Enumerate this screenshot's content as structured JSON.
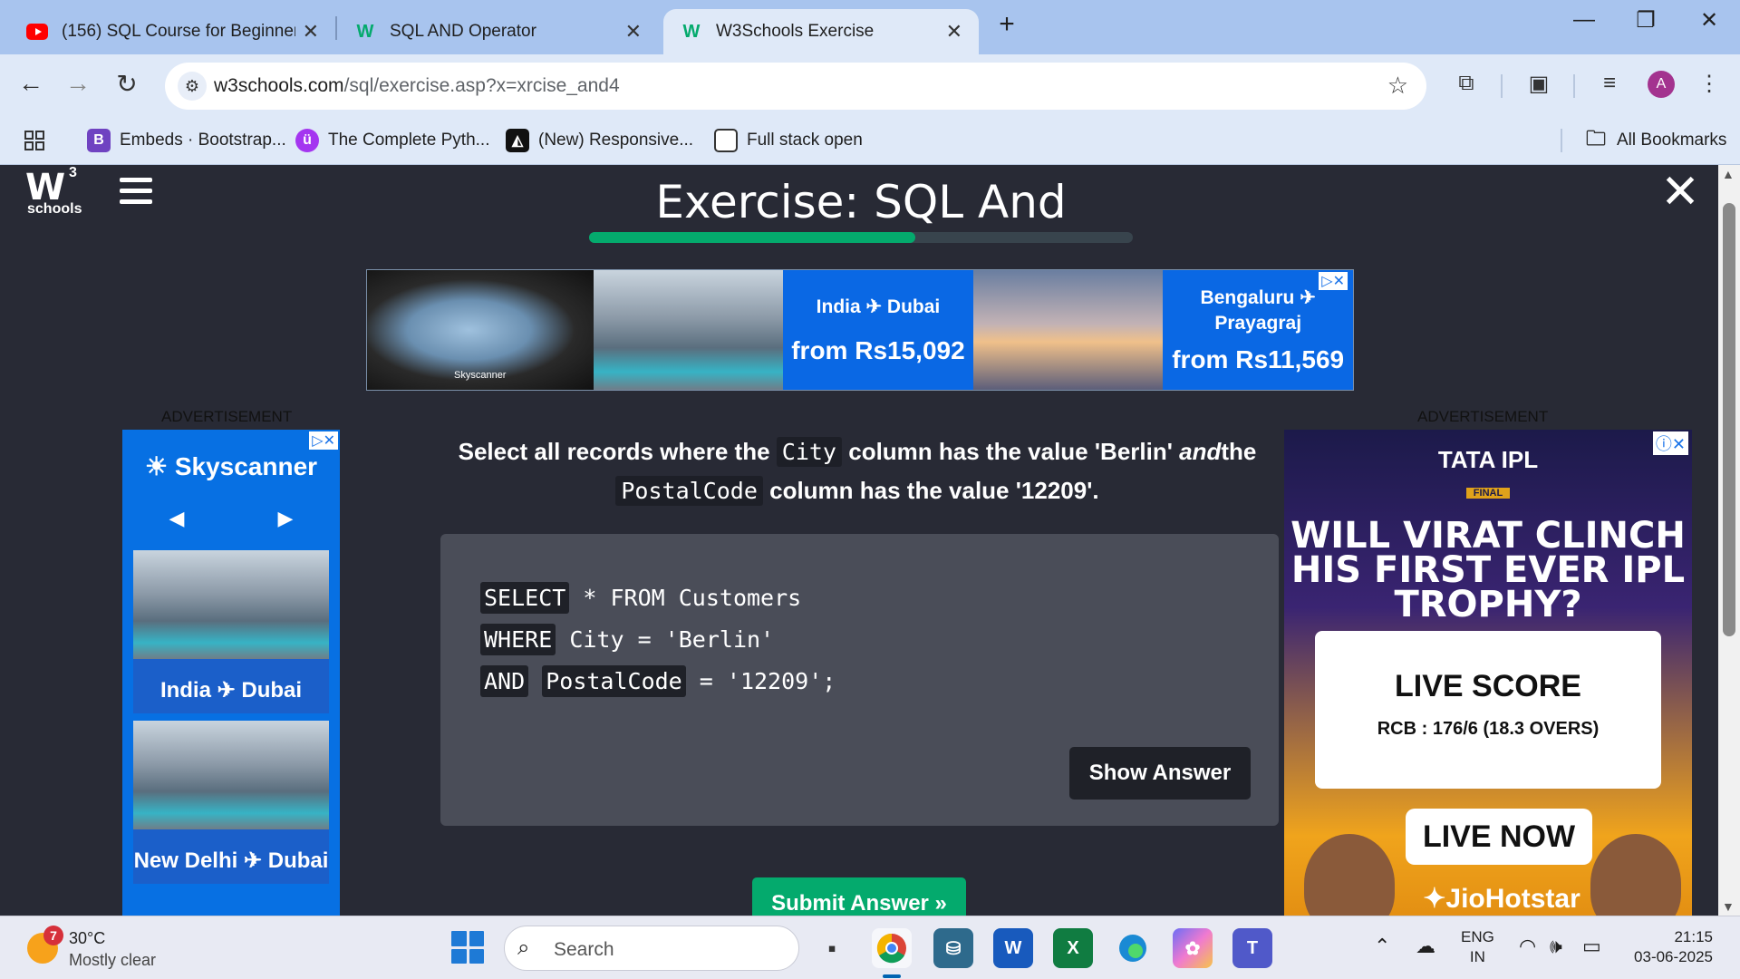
{
  "tabs": [
    {
      "title": "(156) SQL Course for Beginners",
      "favicon": "youtube-icon"
    },
    {
      "title": "SQL AND Operator",
      "favicon": "w3schools-icon"
    },
    {
      "title": "W3Schools Exercise",
      "favicon": "w3schools-icon",
      "active": true
    }
  ],
  "address": {
    "domain": "w3schools.com",
    "path": "/sql/exercise.asp?x=xrcise_and4"
  },
  "profile_initial": "A",
  "bookmarks": [
    {
      "label": "Embeds · Bootstrap...",
      "icon": "bootstrap-icon",
      "letter": "B",
      "color": "#6f42c1"
    },
    {
      "label": "The Complete Pyth...",
      "icon": "udemy-icon",
      "letter": "ü",
      "color": "#a435f0"
    },
    {
      "label": "(New) Responsive...",
      "icon": "codepen-icon",
      "letter": "◭",
      "color": "#111111"
    },
    {
      "label": "Full stack open",
      "icon": "page-icon",
      "letter": "",
      "color": "#ffffff"
    }
  ],
  "all_bookmarks": "All Bookmarks",
  "page": {
    "logo_main": "W",
    "logo_sup": "3",
    "logo_sub": "schools",
    "title": "Exercise: SQL And",
    "progress_fraction": 0.6
  },
  "ads": {
    "label": "ADVERTISEMENT",
    "top": {
      "brand": "Skyscanner",
      "route1": "India ✈ Dubai",
      "price1": "from Rs15,092",
      "route2": "Bengaluru ✈ Prayagraj",
      "price2": "from Rs11,569"
    },
    "left": {
      "brand": "Skyscanner",
      "prev": "◀",
      "next": "▶",
      "card1": "India ✈ Dubai",
      "card2": "New Delhi ✈ Dubai"
    },
    "right": {
      "tournament": "TATA IPL",
      "final": "FINAL",
      "headline": "WILL VIRAT CLINCH HIS FIRST EVER IPL TROPHY?",
      "live_score": "LIVE SCORE",
      "score": "RCB : 176/6  (18.3 OVERS)",
      "live_now": "LIVE NOW",
      "brand": "JioHotstar"
    }
  },
  "exercise": {
    "q_part1": "Select all records where the",
    "q_code1": "City",
    "q_part2": "column has the value 'Berlin'",
    "q_and": "and",
    "q_part3": "the",
    "q_code2": "PostalCode",
    "q_part4": "column has the value '12209'.",
    "line1_kw": "SELECT",
    "line1_rest": "* FROM Customers",
    "line2_kw": "WHERE",
    "line2_rest": "City = 'Berlin'",
    "line3_kw": "AND",
    "line3_field": "PostalCode",
    "line3_rest": "= '12209';",
    "show_answer": "Show Answer",
    "submit": "Submit Answer »"
  },
  "taskbar": {
    "weather_badge": "7",
    "temperature": "30°C",
    "condition": "Mostly clear",
    "search_label": "Search",
    "lang1": "ENG",
    "lang2": "IN",
    "time": "21:15",
    "date": "03-06-2025"
  }
}
